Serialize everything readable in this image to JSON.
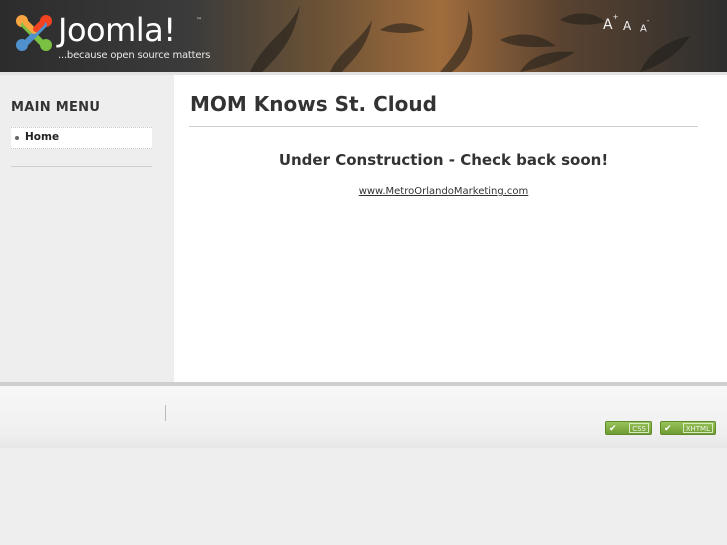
{
  "header": {
    "logo_text": "Joomla!",
    "logo_tm": "™",
    "tagline": "...because open source matters",
    "font_tools": [
      {
        "label": "A",
        "sup": "+"
      },
      {
        "label": "A",
        "sup": ""
      },
      {
        "label": "A",
        "sup": "-"
      }
    ]
  },
  "sidebar": {
    "menu_title": "MAIN MENU",
    "items": [
      {
        "label": "Home"
      }
    ]
  },
  "main": {
    "page_title": "MOM Knows St. Cloud",
    "notice": "Under Construction - Check back soon!",
    "link": "www.MetroOrlandoMarketing.com"
  },
  "footer": {
    "badges": [
      {
        "label": "CSS"
      },
      {
        "label": "XHTML"
      }
    ]
  },
  "colors": {
    "header_dark": "#2c2c2c",
    "header_warm": "#a06c3c",
    "badge_green": "#6f9b34",
    "title_text": "#333333"
  },
  "icons": {
    "logo": "joomla-logo-icon",
    "validator": "checkmark-icon"
  }
}
